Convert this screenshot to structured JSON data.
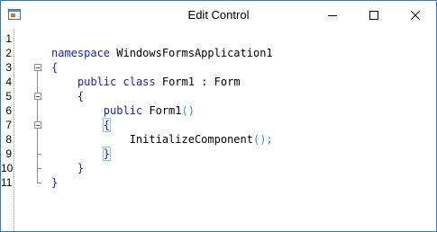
{
  "window": {
    "title": "Edit Control",
    "colors": {
      "border": "#2b79d8",
      "keyword": "#1d1dc8",
      "paren": "#2aa0a0"
    }
  },
  "controls": {
    "minimize_icon": "minimize-icon",
    "maximize_icon": "maximize-icon",
    "close_icon": "close-icon"
  },
  "editor": {
    "line_numbers": [
      "1",
      "2",
      "3",
      "4",
      "5",
      "6",
      "7",
      "8",
      "9",
      "10",
      "11"
    ],
    "lines": [
      {
        "indent": "",
        "parts": []
      },
      {
        "indent": "",
        "parts": [
          {
            "t": "namespace",
            "k": "kw"
          },
          {
            "t": " WindowsFormsApplication1",
            "k": "id"
          }
        ]
      },
      {
        "indent": "",
        "parts": [
          {
            "t": "{",
            "k": "brace"
          }
        ]
      },
      {
        "indent": "    ",
        "parts": [
          {
            "t": "public",
            "k": "kw"
          },
          {
            "t": " ",
            "k": "id"
          },
          {
            "t": "class",
            "k": "kw"
          },
          {
            "t": " Form1 : Form",
            "k": "id"
          }
        ]
      },
      {
        "indent": "    ",
        "parts": [
          {
            "t": "{",
            "k": "brace"
          }
        ]
      },
      {
        "indent": "        ",
        "parts": [
          {
            "t": "public",
            "k": "kw"
          },
          {
            "t": " Form1",
            "k": "id"
          },
          {
            "t": "()",
            "k": "paren"
          }
        ]
      },
      {
        "indent": "        ",
        "parts": [
          {
            "t": "{",
            "k": "brace hl"
          }
        ]
      },
      {
        "indent": "            ",
        "parts": [
          {
            "t": "InitializeComponent",
            "k": "id"
          },
          {
            "t": "()",
            "k": "paren"
          },
          {
            "t": ";",
            "k": "paren"
          }
        ]
      },
      {
        "indent": "        ",
        "parts": [
          {
            "t": "}",
            "k": "brace hl"
          }
        ]
      },
      {
        "indent": "    ",
        "parts": [
          {
            "t": "}",
            "k": "brace"
          }
        ]
      },
      {
        "indent": "",
        "parts": [
          {
            "t": "}",
            "k": "brace"
          }
        ]
      }
    ]
  }
}
